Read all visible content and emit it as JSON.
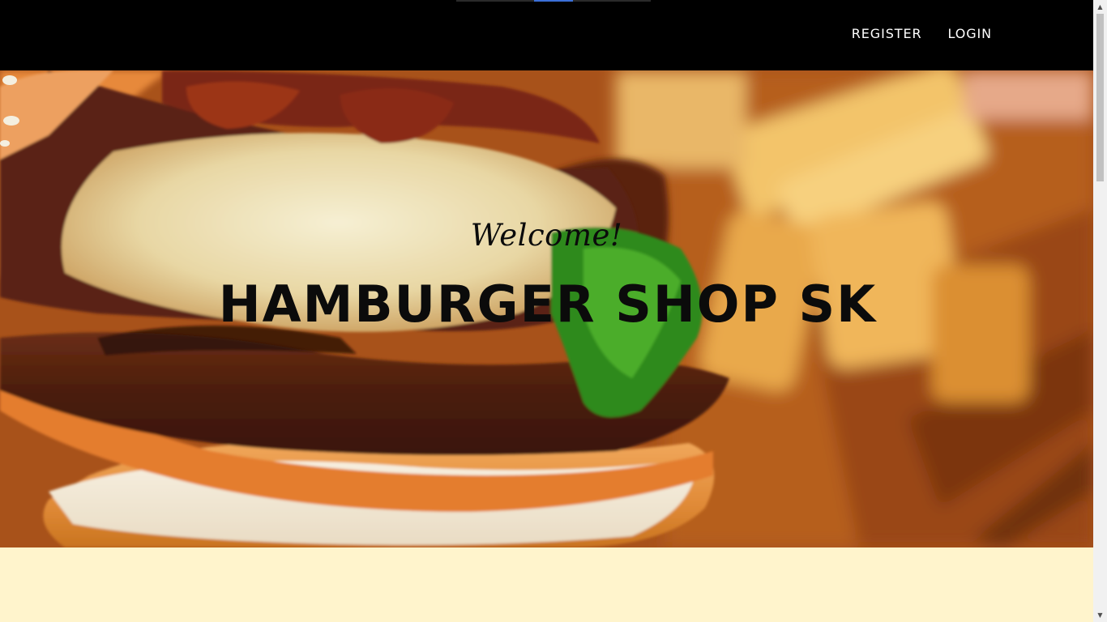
{
  "nav": {
    "links": [
      {
        "label": "REGISTER"
      },
      {
        "label": "LOGIN"
      }
    ],
    "load_progress": 0.2
  },
  "hero": {
    "welcome": "Welcome!",
    "title": "HAMBURGER SHOP SK",
    "background_image": "burger-photo"
  },
  "colors": {
    "navbar_bg": "#000000",
    "content_bg": "#fff4cc",
    "hero_text": "#0b0b0b"
  }
}
